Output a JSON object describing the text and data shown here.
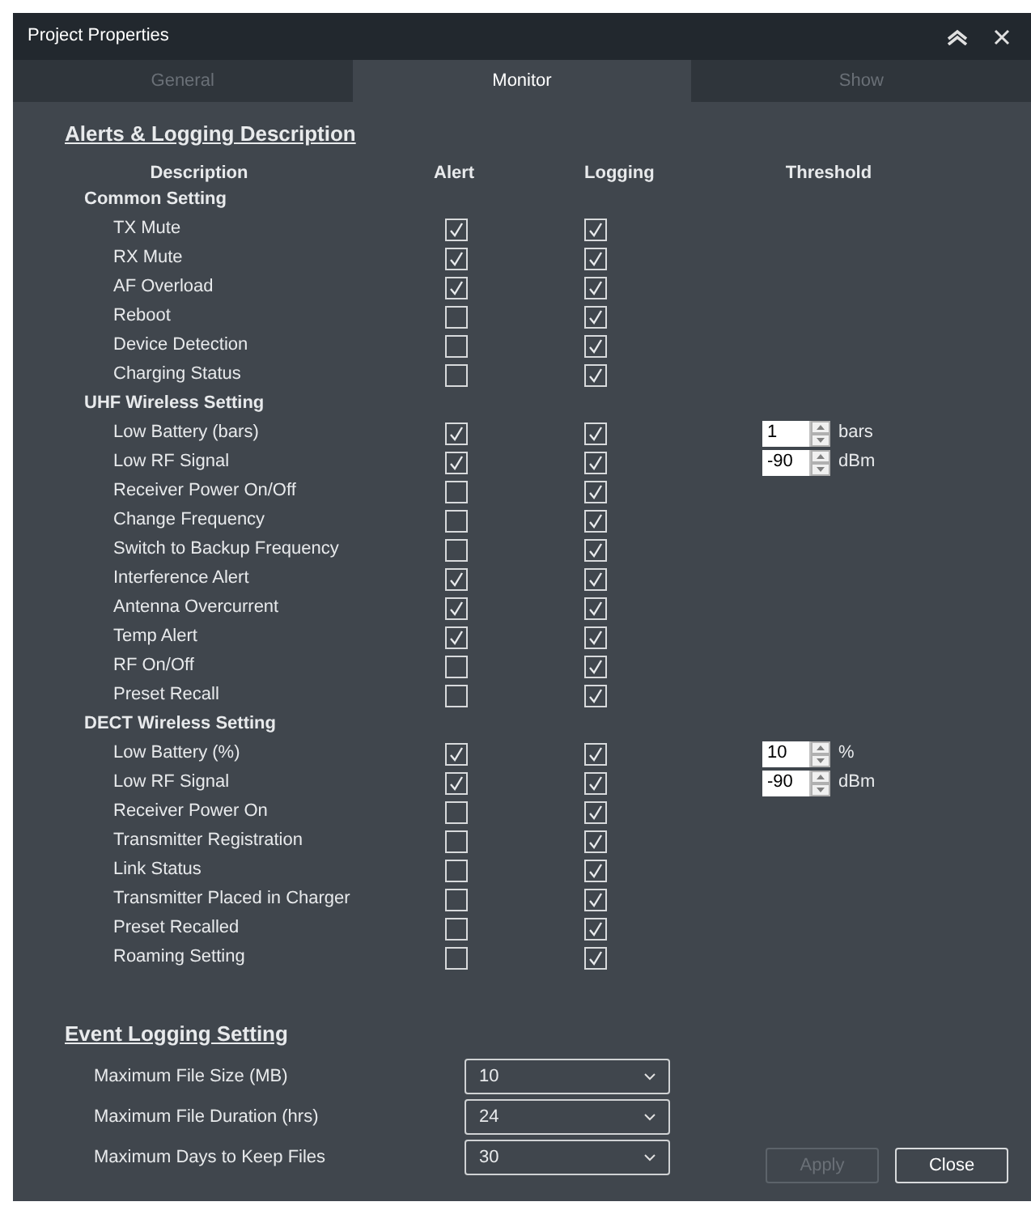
{
  "window": {
    "title": "Project Properties"
  },
  "tabs": [
    {
      "label": "General",
      "selected": false
    },
    {
      "label": "Monitor",
      "selected": true
    },
    {
      "label": "Show",
      "selected": false
    }
  ],
  "alerts_section": {
    "heading": "Alerts & Logging Description",
    "columns": [
      "Description",
      "Alert",
      "Logging",
      "Threshold"
    ],
    "groups": [
      {
        "title": "Common Setting",
        "items": [
          {
            "label": "TX Mute",
            "alert": true,
            "logging": true
          },
          {
            "label": "RX Mute",
            "alert": true,
            "logging": true
          },
          {
            "label": "AF Overload",
            "alert": true,
            "logging": true
          },
          {
            "label": "Reboot",
            "alert": false,
            "logging": true
          },
          {
            "label": "Device Detection",
            "alert": false,
            "logging": true
          },
          {
            "label": "Charging Status",
            "alert": false,
            "logging": true
          }
        ]
      },
      {
        "title": "UHF Wireless Setting",
        "items": [
          {
            "label": "Low Battery (bars)",
            "alert": true,
            "logging": true,
            "threshold": {
              "value": "1",
              "unit": "bars"
            }
          },
          {
            "label": "Low RF Signal",
            "alert": true,
            "logging": true,
            "threshold": {
              "value": "-90",
              "unit": "dBm"
            }
          },
          {
            "label": "Receiver Power On/Off",
            "alert": false,
            "logging": true
          },
          {
            "label": "Change Frequency",
            "alert": false,
            "logging": true
          },
          {
            "label": "Switch to Backup Frequency",
            "alert": false,
            "logging": true
          },
          {
            "label": "Interference Alert",
            "alert": true,
            "logging": true
          },
          {
            "label": "Antenna Overcurrent",
            "alert": true,
            "logging": true
          },
          {
            "label": "Temp Alert",
            "alert": true,
            "logging": true
          },
          {
            "label": "RF On/Off",
            "alert": false,
            "logging": true
          },
          {
            "label": "Preset Recall",
            "alert": false,
            "logging": true
          }
        ]
      },
      {
        "title": "DECT Wireless Setting",
        "items": [
          {
            "label": "Low Battery (%)",
            "alert": true,
            "logging": true,
            "threshold": {
              "value": "10",
              "unit": "%"
            }
          },
          {
            "label": "Low RF Signal",
            "alert": true,
            "logging": true,
            "threshold": {
              "value": "-90",
              "unit": "dBm"
            }
          },
          {
            "label": "Receiver Power On",
            "alert": false,
            "logging": true
          },
          {
            "label": "Transmitter Registration",
            "alert": false,
            "logging": true
          },
          {
            "label": "Link Status",
            "alert": false,
            "logging": true
          },
          {
            "label": "Transmitter Placed in Charger",
            "alert": false,
            "logging": true
          },
          {
            "label": "Preset Recalled",
            "alert": false,
            "logging": true
          },
          {
            "label": "Roaming Setting",
            "alert": false,
            "logging": true
          }
        ]
      }
    ]
  },
  "event_logging": {
    "heading": "Event Logging Setting",
    "settings": [
      {
        "label": "Maximum File Size (MB)",
        "value": "10"
      },
      {
        "label": "Maximum File Duration (hrs)",
        "value": "24"
      },
      {
        "label": "Maximum Days to Keep Files",
        "value": "30"
      }
    ]
  },
  "buttons": [
    {
      "label": "Apply",
      "disabled": true
    },
    {
      "label": "Close",
      "disabled": false
    }
  ]
}
